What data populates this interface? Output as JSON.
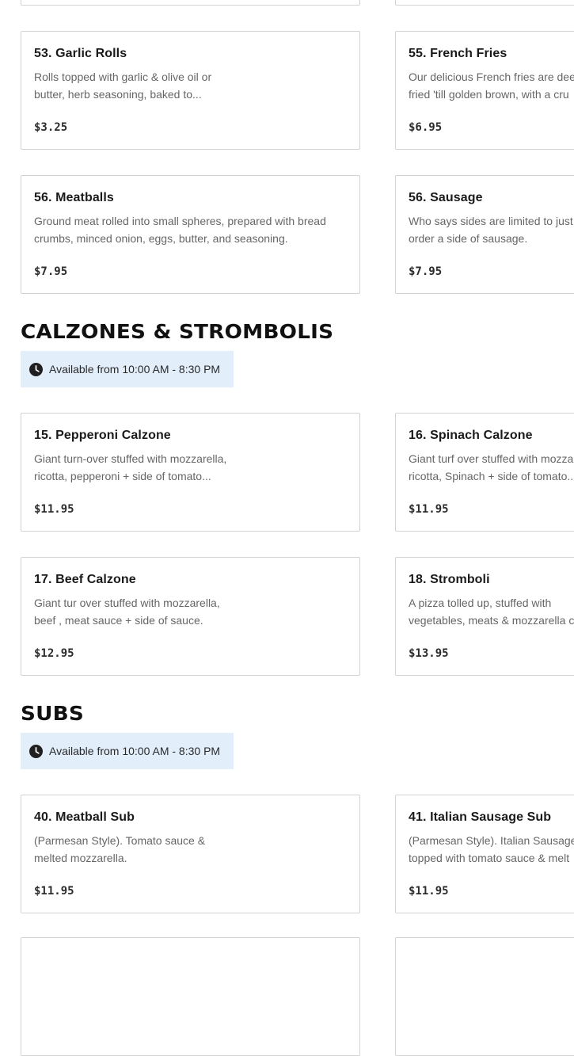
{
  "sections": {
    "sides": {
      "items": [
        {
          "title": "53. Garlic Rolls",
          "description": "Rolls topped with garlic & olive oil or\nbutter, herb seasoning, baked to...",
          "price": "$3.25"
        },
        {
          "title": "55. French Fries",
          "description": "Our delicious French fries are dee\nfried 'till golden brown, with a cru",
          "price": "$6.95"
        },
        {
          "title": "56. Meatballs",
          "description": "Ground meat rolled into small spheres, prepared with bread\ncrumbs, minced onion, eggs, butter, and seasoning.",
          "price": "$7.95"
        },
        {
          "title": "56. Sausage",
          "description": "Who says sides are limited to just\norder a side of sausage.",
          "price": "$7.95"
        }
      ]
    },
    "calzones": {
      "title": "CALZONES & STROMBOLIS",
      "hours": "Available from 10:00 AM - 8:30 PM",
      "items": [
        {
          "title": "15. Pepperoni Calzone",
          "description": "Giant turn-over stuffed with mozzarella,\nricotta, pepperoni + side of tomato...",
          "price": "$11.95"
        },
        {
          "title": "16. Spinach Calzone",
          "description": "Giant turf over stuffed with mozza\nricotta, Spinach + side of tomato...",
          "price": "$11.95"
        },
        {
          "title": "17. Beef Calzone",
          "description": "Giant tur over stuffed with mozzarella,\nbeef , meat sauce + side of sauce.",
          "price": "$12.95"
        },
        {
          "title": "18. Stromboli",
          "description": "A pizza tolled up, stuffed with\nvegetables, meats & mozzarella ch",
          "price": "$13.95"
        }
      ]
    },
    "subs": {
      "title": "SUBS",
      "hours": "Available from 10:00 AM - 8:30 PM",
      "items": [
        {
          "title": "40. Meatball Sub",
          "description": "(Parmesan Style). Tomato sauce &\nmelted mozzarella.",
          "price": "$11.95"
        },
        {
          "title": "41. Italian Sausage Sub",
          "description": "(Parmesan Style). Italian Sausage\ntopped with tomato sauce & melt",
          "price": "$11.95"
        }
      ]
    }
  },
  "icons": {
    "hours": "clock-icon"
  },
  "colors": {
    "hours_badge_bg": "#e3eefb",
    "card_border": "#d3d3d3",
    "description_text": "#666666"
  }
}
